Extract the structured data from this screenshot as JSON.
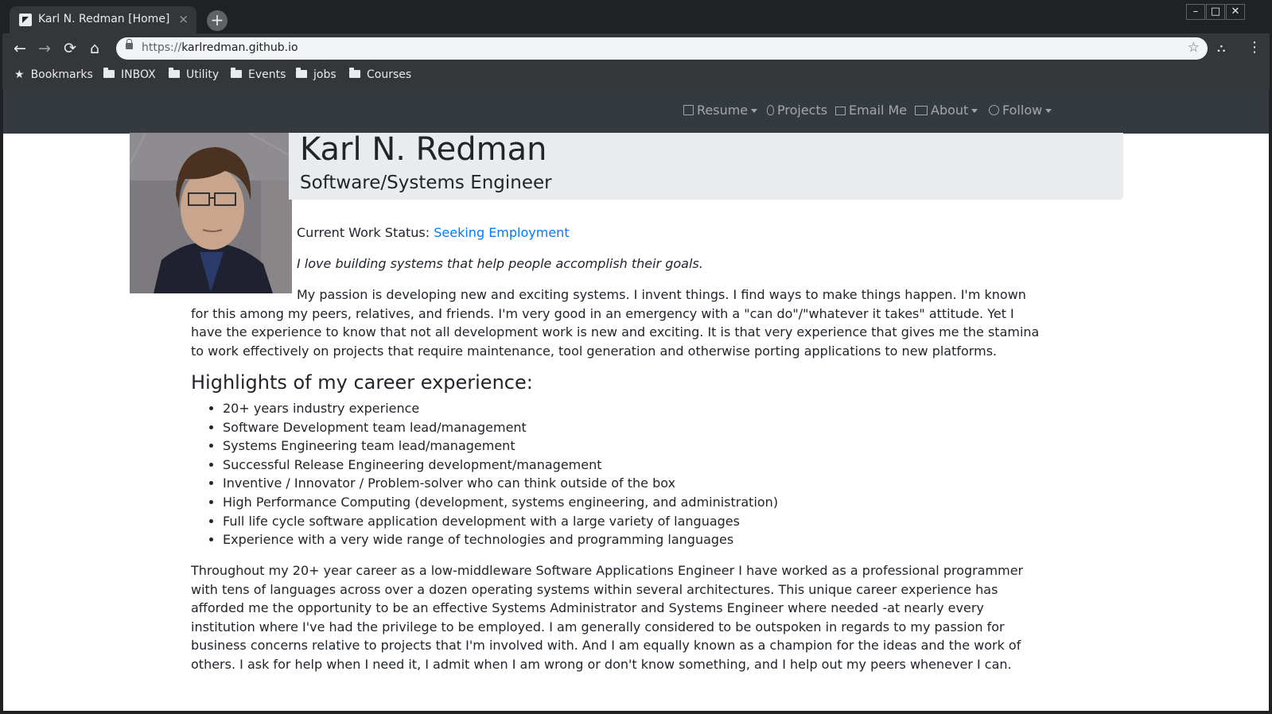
{
  "browser": {
    "tab_title": "Karl N. Redman [Home]",
    "tab_close": "×",
    "new_tab": "+",
    "url_scheme": "https://",
    "url_host": "karlredman.github.io",
    "bookmarks": [
      "Bookmarks",
      "INBOX",
      "Utility",
      "Events",
      "jobs",
      "Courses"
    ]
  },
  "navbar": {
    "items": [
      "Resume",
      "Projects",
      "Email Me",
      "About",
      "Follow"
    ]
  },
  "header": {
    "name": "Karl N. Redman",
    "title": "Software/Systems Engineer"
  },
  "status": {
    "label": "Current Work Status: ",
    "value": "Seeking Employment"
  },
  "tagline": "I love building systems that help people accomplish their goals.",
  "intro": "My passion is developing new and exciting systems. I invent things. I find ways to make things happen. I'm known for this among my peers, relatives, and friends. I'm very good in an emergency with a \"can do\"/\"whatever it takes\" attitude. Yet I have the experience to know that not all development work is new and exciting. It is that very experience that gives me the stamina to work effectively on projects that require maintenance, tool generation and otherwise porting applications to new platforms.",
  "highlights": {
    "heading": "Highlights of my career experience:",
    "items": [
      "20+ years industry experience",
      "Software Development team lead/management",
      "Systems Engineering team lead/management",
      "Successful Release Engineering development/management",
      "Inventive / Innovator / Problem-solver who can think outside of the box",
      "High Performance Computing (development, systems engineering, and administration)",
      "Full life cycle software application development with a large variety of languages",
      "Experience with a very wide range of technologies and programming languages"
    ]
  },
  "summary": "Throughout my 20+ year career as a low-middleware Software Applications Engineer I have worked as a professional programmer with tens of languages across over a dozen operating systems within several architectures. This unique career experience has afforded me the opportunity to be an effective Systems Administrator and Systems Engineer where needed -at nearly every institution where I've had the privilege to be employed. I am generally considered to be outspoken in regards to my passion for business concerns relative to projects that I'm involved with. And I am equally known as a champion for the ideas and the work of others. I ask for help when I need it, I admit when I am wrong or don't know something, and I help out my peers whenever I can."
}
